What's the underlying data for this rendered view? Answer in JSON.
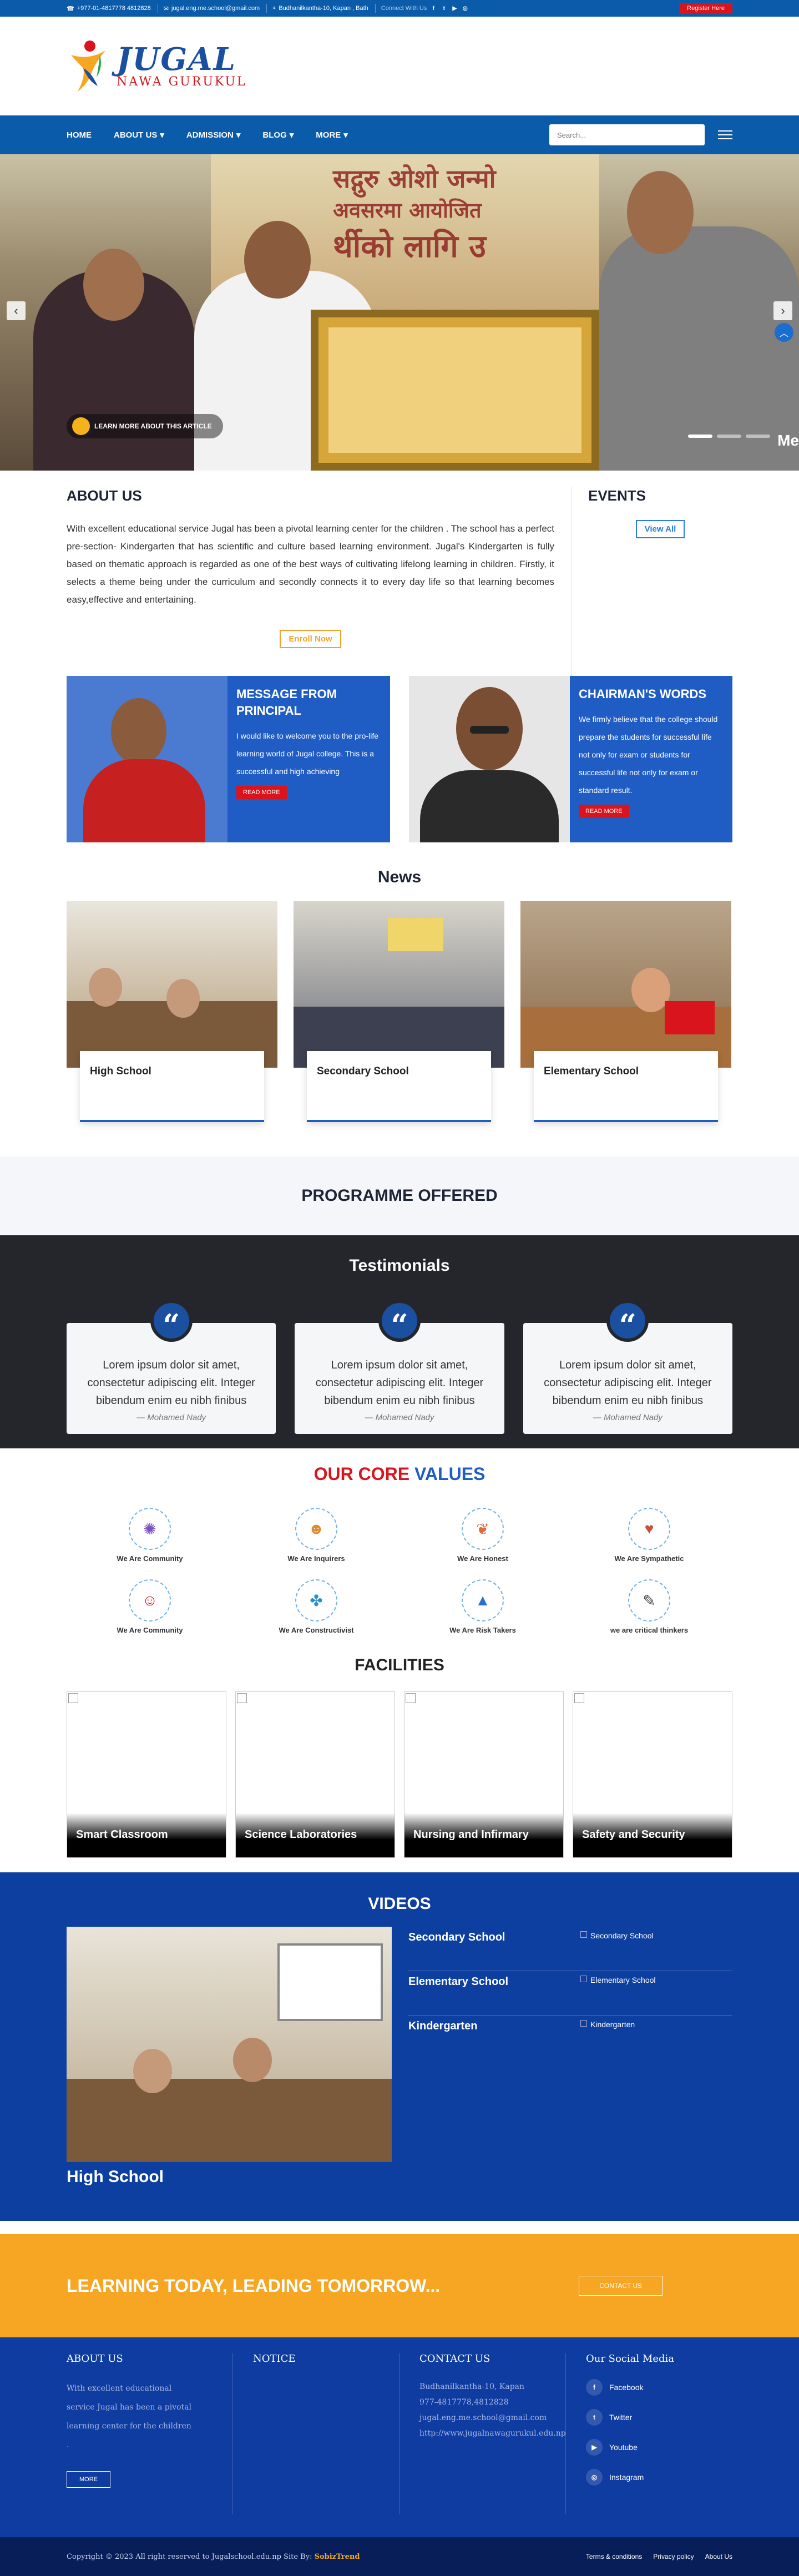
{
  "topbar": {
    "phone": "+977-01-4817778 4812828",
    "email": "jugal.eng.me.school@gmail.com",
    "address": "Budhanilkantha-10, Kapan , Bath",
    "connect": "Connect With Us",
    "register": "Register Here"
  },
  "logo": {
    "name": "JUGAL",
    "sub": "NAWA GURUKUL"
  },
  "nav": {
    "items": [
      "HOME",
      "ABOUT US",
      "ADMISSION",
      "BLOG",
      "MORE"
    ],
    "search_placeholder": "Search..."
  },
  "hero": {
    "banner_text": "सद्गुरु ओशो जन्मो",
    "banner_text2": "अवसरमा आयोजित",
    "banner_text3": "र्थीको लागि उ",
    "cta": "LEARN MORE ABOUT THIS ARTICLE",
    "side_text": "Me"
  },
  "about": {
    "title": "ABOUT US",
    "text": "With excellent educational service Jugal has been a pivotal learning center for the children . The school has a perfect pre-section- Kindergarten that has scientific and culture based learning environment. Jugal's Kindergarten is fully based on thematic approach is regarded as one of the best ways of cultivating lifelong learning in children. Firstly, it selects a theme being under the curriculum and secondly connects it to every day life so that learning becomes easy,effective and entertaining.",
    "button": "Enroll Now"
  },
  "events": {
    "title": "EVENTS",
    "button": "View All"
  },
  "messages": [
    {
      "title": "MESSAGE FROM PRINCIPAL",
      "text": "I would like to welcome you to the pro-life learning world of Jugal college. This is a successful and high achieving",
      "button": "READ MORE"
    },
    {
      "title": "CHAIRMAN'S WORDS",
      "text": "We firmly believe that the college should prepare the students for successful life not only for exam or students for successful life not only for exam or standard result.",
      "button": "READ MORE"
    }
  ],
  "news": {
    "title": "News",
    "items": [
      "High School",
      "Secondary School",
      "Elementary School"
    ]
  },
  "programme": {
    "title": "PROGRAMME OFFERED"
  },
  "testimonials": {
    "title": "Testimonials",
    "items": [
      {
        "text": "Lorem ipsum dolor sit amet, consectetur adipiscing elit. Integer bibendum enim eu nibh finibus",
        "author": "— Mohamed Nady"
      },
      {
        "text": "Lorem ipsum dolor sit amet, consectetur adipiscing elit. Integer bibendum enim eu nibh finibus",
        "author": "— Mohamed Nady"
      },
      {
        "text": "Lorem ipsum dolor sit amet, consectetur adipiscing elit. Integer bibendum enim eu nibh finibus",
        "author": "— Mohamed Nady"
      }
    ]
  },
  "values": {
    "title_red": "OUR CORE",
    "title_blue": "VALUES",
    "items": [
      {
        "label": "We Are Community",
        "icon": "community-icon"
      },
      {
        "label": "We Are Inquirers",
        "icon": "inquirers-icon"
      },
      {
        "label": "We Are Honest",
        "icon": "honest-icon"
      },
      {
        "label": "We Are Sympathetic",
        "icon": "sympathetic-icon"
      },
      {
        "label": "We Are Community",
        "icon": "community-icon"
      },
      {
        "label": "We Are Constructivist",
        "icon": "constructivist-icon"
      },
      {
        "label": "We Are Risk Takers",
        "icon": "risk-takers-icon"
      },
      {
        "label": "we are critical thinkers",
        "icon": "critical-thinkers-icon"
      }
    ]
  },
  "facilities": {
    "title": "FACILITIES",
    "items": [
      "Smart Classroom",
      "Science Laboratories",
      "Nursing and Infirmary",
      "Safety and Security"
    ]
  },
  "videos": {
    "title": "VIDEOS",
    "main_caption": "High School",
    "items": [
      {
        "title": "Secondary School",
        "img_alt": "Secondary School"
      },
      {
        "title": "Elementary School",
        "img_alt": "Elementary School"
      },
      {
        "title": "Kindergarten",
        "img_alt": "Kindergarten"
      }
    ]
  },
  "cta": {
    "text": "LEARNING TODAY, LEADING TOMORROW...",
    "button": "CONTACT US"
  },
  "footer": {
    "about_title": "ABOUT US",
    "about_text": "With excellent educational service Jugal has been a pivotal learning center for the children .",
    "more": "MORE",
    "notice_title": "NOTICE",
    "contact_title": "CONTACT US",
    "contact": [
      "Budhanilkantha-10, Kapan",
      "977-4817778,4812828",
      "jugal.eng.me.school@gmail.com",
      "http://www.jugalnawagurukul.edu.np"
    ],
    "social_title": "Our Social Media",
    "social": [
      "Facebook",
      "Twitter",
      "Youtube",
      "Instagram"
    ]
  },
  "copyright": {
    "text": "Copyright © 2023 All right reserved to Jugalschool.edu.np Site By:",
    "site_by": "SobizTrend",
    "links": [
      "Terms & conditions",
      "Privacy policy",
      "About Us"
    ]
  },
  "colors": {
    "primary": "#0a5cab",
    "accent": "#f6a623",
    "red": "#d9141c",
    "dark": "#24262b"
  }
}
